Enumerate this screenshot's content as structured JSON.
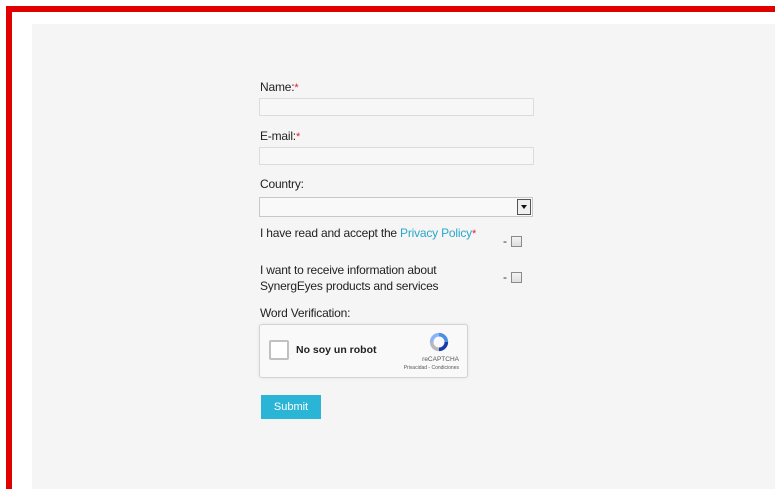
{
  "form": {
    "name_label": "Name:",
    "email_label": "E-mail:",
    "required_mark": "*",
    "country_label": "Country:",
    "country_selected": "",
    "privacy_prefix": "I have read and accept the ",
    "privacy_link": "Privacy Policy",
    "newsletter_label": "I want to receive information about SynergEyes products and services",
    "checkbox_dash": "-",
    "verification_label": "Word Verification:",
    "submit_label": "Submit"
  },
  "recaptcha": {
    "label": "No soy un robot",
    "brand": "reCAPTCHA",
    "terms": "Privacidad - Condiciones"
  },
  "colors": {
    "frame": "#e00000",
    "accent": "#2ab5d6",
    "link": "#2aa7c9",
    "required": "#e0202a"
  }
}
